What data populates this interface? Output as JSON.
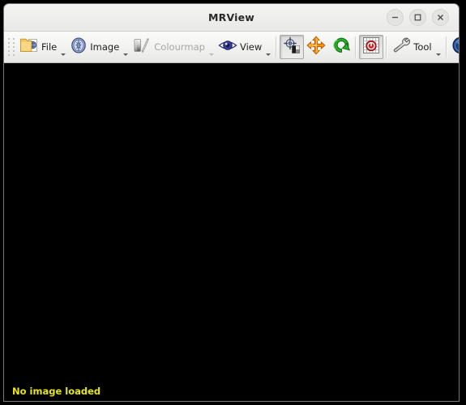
{
  "window": {
    "title": "MRView",
    "controls": [
      {
        "name": "minimize",
        "glyph": "minimize-icon",
        "label": "Minimize"
      },
      {
        "name": "maximize",
        "glyph": "maximize-icon",
        "label": "Maximize"
      },
      {
        "name": "close",
        "glyph": "close-icon",
        "label": "Close"
      }
    ]
  },
  "toolbar": {
    "grip": "drag-handle",
    "items": [
      {
        "id": "file",
        "label": "File",
        "icon": "folder-brain-icon",
        "enabled": true,
        "has_menu": true,
        "pressed": false
      },
      {
        "id": "image",
        "label": "Image",
        "icon": "brain-scan-icon",
        "enabled": true,
        "has_menu": true,
        "pressed": false
      },
      {
        "id": "colourmap",
        "label": "Colourmap",
        "icon": "colourmap-icon",
        "enabled": false,
        "has_menu": true,
        "pressed": false
      },
      {
        "id": "view",
        "label": "View",
        "icon": "eye-icon",
        "enabled": true,
        "has_menu": true,
        "pressed": false
      },
      {
        "id": "contrast",
        "label": "",
        "icon": "crosshair-contrast-icon",
        "enabled": true,
        "has_menu": false,
        "pressed": true
      },
      {
        "id": "move",
        "label": "",
        "icon": "move-arrows-icon",
        "enabled": true,
        "has_menu": false,
        "pressed": false
      },
      {
        "id": "rotate",
        "label": "",
        "icon": "rotate-arrow-icon",
        "enabled": true,
        "has_menu": false,
        "pressed": false
      },
      {
        "id": "lock",
        "label": "",
        "icon": "lock-grid-icon",
        "enabled": true,
        "has_menu": false,
        "pressed": true
      },
      {
        "id": "tool",
        "label": "Tool",
        "icon": "wrench-icon",
        "enabled": true,
        "has_menu": true,
        "pressed": false
      },
      {
        "id": "info",
        "label": "",
        "icon": "info-icon",
        "enabled": true,
        "has_menu": true,
        "pressed": false
      }
    ]
  },
  "canvas": {
    "background": "#000000",
    "status": "No image loaded",
    "status_color": "#e8e800"
  }
}
